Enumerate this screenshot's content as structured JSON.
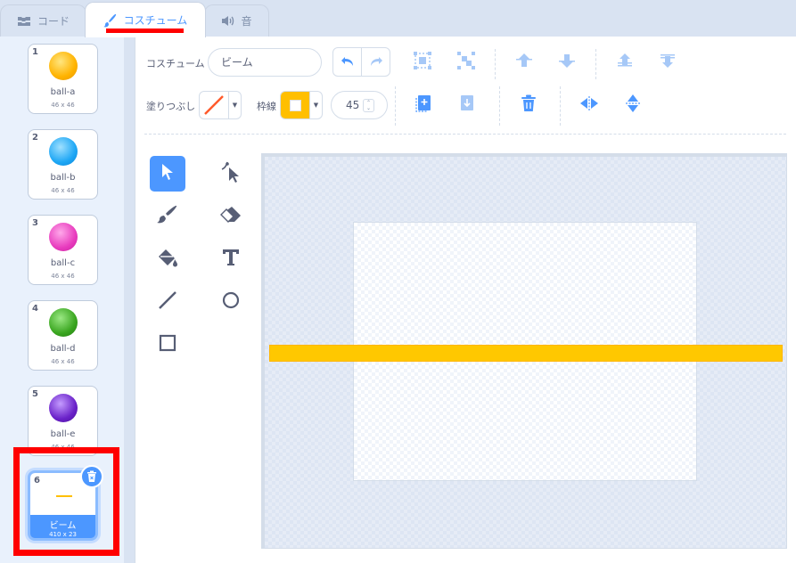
{
  "tabs": [
    {
      "label": "コード",
      "icon": "code-blocks-icon"
    },
    {
      "label": "コスチューム",
      "icon": "paintbrush-icon"
    },
    {
      "label": "音",
      "icon": "speaker-icon"
    }
  ],
  "costumes": [
    {
      "num": "1",
      "name": "ball-a",
      "size": "46 x 46",
      "color": "#ffb300"
    },
    {
      "num": "2",
      "name": "ball-b",
      "size": "46 x 46",
      "color": "#1ea7f5"
    },
    {
      "num": "3",
      "name": "ball-c",
      "size": "46 x 46",
      "color": "#e83cbe"
    },
    {
      "num": "4",
      "name": "ball-d",
      "size": "46 x 46",
      "color": "#3aa620"
    },
    {
      "num": "5",
      "name": "ball-e",
      "size": "46 x 46",
      "color": "#6a22c9"
    },
    {
      "num": "6",
      "name": "ビーム",
      "size": "410 x 23",
      "selected": true
    }
  ],
  "editor": {
    "costume_label": "コスチューム",
    "costume_name": "ビーム",
    "fill_label": "塗りつぶし",
    "stroke_label": "枠線",
    "stroke_width": "45",
    "fill_color": "none",
    "stroke_color": "#ffbf00",
    "beam_color": "#ffc800"
  },
  "colors": {
    "accent": "#4c97ff",
    "highlight": "#ff0000"
  }
}
